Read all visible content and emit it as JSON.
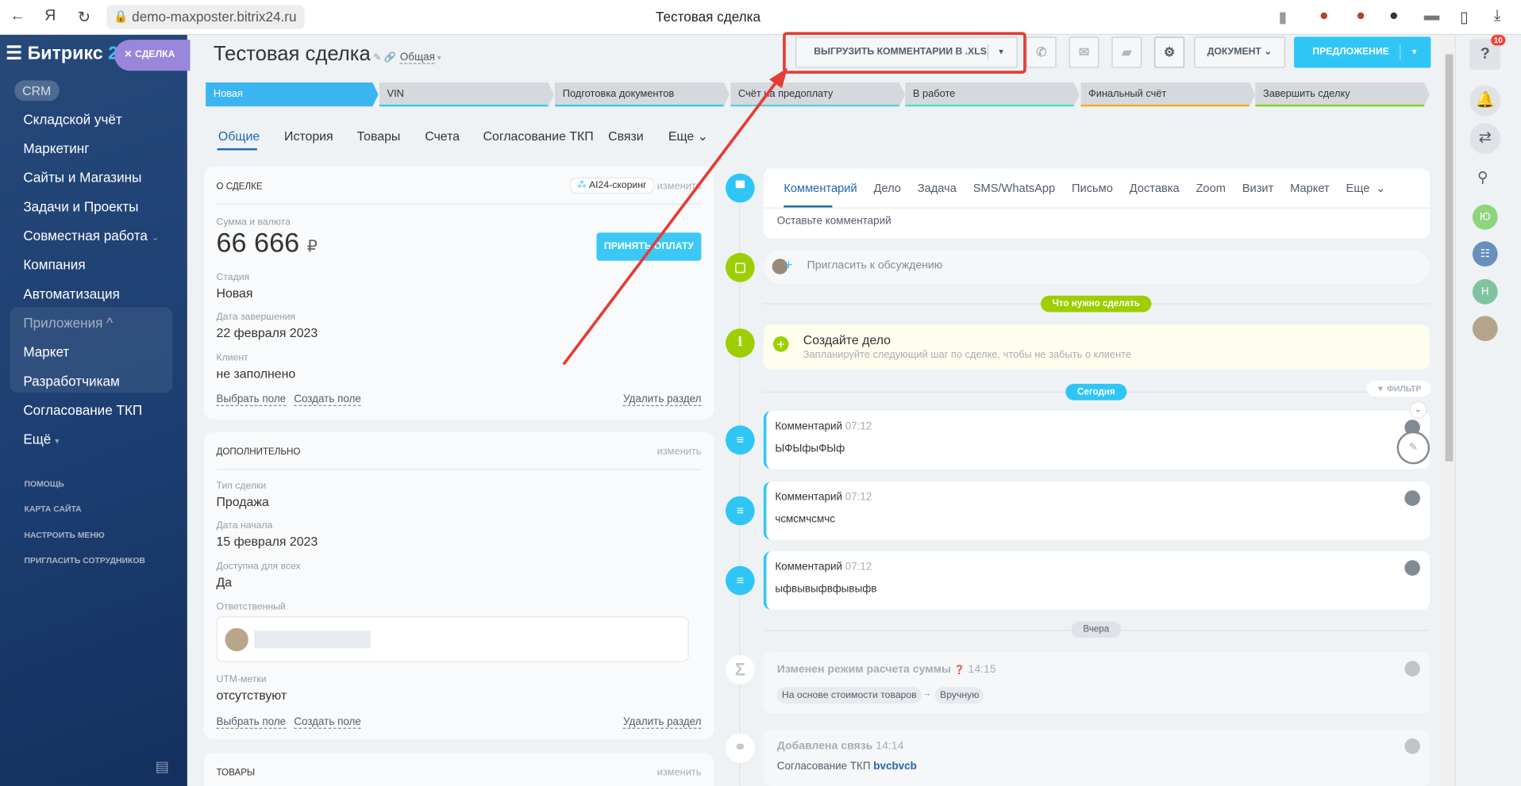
{
  "browser": {
    "url": "demo-maxposter.bitrix24.ru",
    "title": "Тестовая сделка"
  },
  "sidebar": {
    "logo_main": "Битрикс",
    "logo_accent": "24",
    "deal_pill": "СДЕЛКА",
    "crm": "CRM",
    "items": [
      "Складской учёт",
      "Маркетинг",
      "Сайты и Магазины",
      "Задачи и Проекты",
      "Совместная работа",
      "Компания",
      "Автоматизация",
      "Приложения",
      "Маркет",
      "Разработчикам",
      "Согласование ТКП",
      "Ещё"
    ],
    "footer": [
      "ПОМОЩЬ",
      "КАРТА САЙТА",
      "НАСТРОИТЬ МЕНЮ",
      "ПРИГЛАСИТЬ СОТРУДНИКОВ"
    ]
  },
  "header": {
    "title": "Тестовая сделка",
    "category": "Общая",
    "export_btn": "ВЫГРУЗИТЬ КОММЕНТАРИИ В .XLS",
    "document_btn": "ДОКУМЕНТ",
    "offer_btn": "ПРЕДЛОЖЕНИЕ"
  },
  "stages": [
    {
      "label": "Новая",
      "color": "#3bb5f0"
    },
    {
      "label": "VIN",
      "color": "#2fc6f6"
    },
    {
      "label": "Подготовка документов",
      "color": "#2fc6f6"
    },
    {
      "label": "Счёт на предоплату",
      "color": "#55d0e0"
    },
    {
      "label": "В работе",
      "color": "#47e4c2"
    },
    {
      "label": "Финальный счёт",
      "color": "#ffa900"
    },
    {
      "label": "Завершить сделку",
      "color": "#7bd500"
    }
  ],
  "tabs": [
    "Общие",
    "История",
    "Товары",
    "Счета",
    "Согласование ТКП",
    "Связи",
    "Еще"
  ],
  "about": {
    "header": "О сделке",
    "scoring": "AI24-скоринг",
    "change": "изменить",
    "sum_label": "Сумма и валюта",
    "sum": "66 666",
    "currency": "₽",
    "pay_btn": "ПРИНЯТЬ ОПЛАТУ",
    "stage_label": "Стадия",
    "stage": "Новая",
    "close_label": "Дата завершения",
    "close_date": "22 февраля 2023",
    "client_label": "Клиент",
    "client": "не заполнено",
    "select_field": "Выбрать поле",
    "create_field": "Создать поле",
    "delete_section": "Удалить раздел"
  },
  "extra": {
    "header": "Дополнительно",
    "change": "изменить",
    "type_label": "Тип сделки",
    "type": "Продажа",
    "start_label": "Дата начала",
    "start": "15 февраля 2023",
    "avail_label": "Доступна для всех",
    "avail": "Да",
    "resp_label": "Ответственный",
    "utm_label": "UTM-метки",
    "utm": "отсутствуют",
    "select_field": "Выбрать поле",
    "create_field": "Создать поле",
    "delete_section": "Удалить раздел"
  },
  "goods": {
    "header": "Товары",
    "change": "изменить"
  },
  "timeline": {
    "tabs": [
      "Комментарий",
      "Дело",
      "Задача",
      "SMS/WhatsApp",
      "Письмо",
      "Доставка",
      "Zoom",
      "Визит",
      "Маркет",
      "Еще"
    ],
    "placeholder": "Оставьте комментарий",
    "invite": "Пригласить к обсуждению",
    "todo_pill": "Что нужно сделать",
    "create_title": "Создайте дело",
    "create_sub": "Запланируйте следующий шаг по сделке, чтобы не забыть о клиенте",
    "today": "Сегодня",
    "filter": "ФИЛЬТР",
    "yesterday": "Вчера",
    "comments": [
      {
        "title": "Комментарий",
        "time": "07:12",
        "text": "ЫФЫфыФЫф"
      },
      {
        "title": "Комментарий",
        "time": "07:12",
        "text": "чсмсмчсмчс"
      },
      {
        "title": "Комментарий",
        "time": "07:12",
        "text": "ыфвывыфвфывыфв"
      }
    ],
    "sum_mode": {
      "title": "Изменен режим расчета суммы",
      "time": "14:15",
      "from": "На основе стоимости товаров",
      "to": "Вручную"
    },
    "link": {
      "title": "Добавлена связь",
      "time": "14:14",
      "prefix": "Согласование ТКП",
      "target": "bvcbvcb"
    }
  },
  "rightbar": {
    "badge": "10",
    "avatars": [
      "Ю",
      "Н"
    ]
  }
}
